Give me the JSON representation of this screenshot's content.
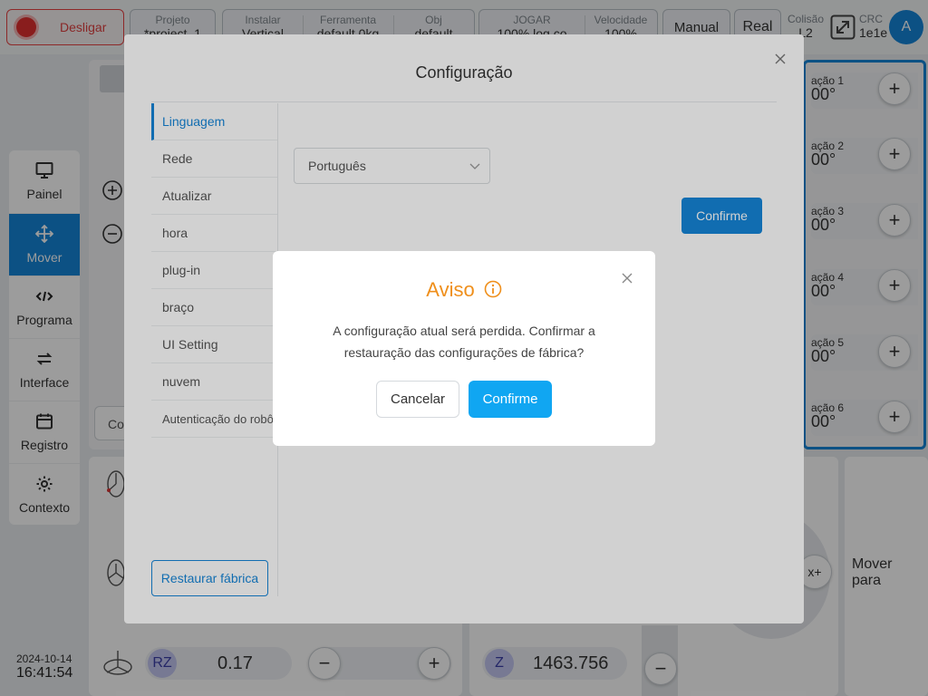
{
  "topbar": {
    "power_label": "Desligar",
    "project": {
      "label": "Projeto",
      "value": "*project_1"
    },
    "install": {
      "label": "Instalar",
      "value": "Vertical"
    },
    "tool": {
      "label": "Ferramenta",
      "value": "default    0kg"
    },
    "obj": {
      "label": "Obj",
      "value": "default"
    },
    "jog": {
      "label": "JOGAR",
      "value": "100%    log co"
    },
    "speed": {
      "label": "Velocidade",
      "value": "100%"
    },
    "mode": "Manual",
    "real": "Real",
    "collision": {
      "label": "Colisão",
      "value": "L2"
    },
    "crc": {
      "label": "CRC",
      "value": "1e1e"
    },
    "avatar": "A"
  },
  "nav": [
    {
      "label": "Painel",
      "icon": "monitor-icon"
    },
    {
      "label": "Mover",
      "icon": "move-icon",
      "active": true
    },
    {
      "label": "Programa",
      "icon": "code-icon"
    },
    {
      "label": "Interface",
      "icon": "swap-icon"
    },
    {
      "label": "Registro",
      "icon": "calendar-icon"
    },
    {
      "label": "Contexto",
      "icon": "gear-icon"
    }
  ],
  "datetime": {
    "date": "2024-10-14",
    "time": "16:41:54"
  },
  "background": {
    "joints": [
      {
        "name": "ação 1",
        "value": "00°"
      },
      {
        "name": "ação 2",
        "value": "00°"
      },
      {
        "name": "ação 3",
        "value": "00°"
      },
      {
        "name": "ação 4",
        "value": "00°"
      },
      {
        "name": "ação 5",
        "value": "00°"
      },
      {
        "name": "ação 6",
        "value": "00°"
      }
    ],
    "co_label": "Co",
    "move_to": "Mover para",
    "rz": {
      "axis": "RZ",
      "value": "0.17"
    },
    "z": {
      "axis": "Z",
      "value": "1463.756"
    },
    "x_plus": "x+"
  },
  "config": {
    "title": "Configuração",
    "menu": [
      "Linguagem",
      "Rede",
      "Atualizar",
      "hora",
      "plug-in",
      "braço",
      "UI Setting",
      "nuvem",
      "Autenticação do robô"
    ],
    "language_value": "Português",
    "confirm_label": "Confirme",
    "restore_label": "Restaurar fábrica"
  },
  "modal": {
    "title": "Aviso",
    "message": "A configuração atual será perdida. Confirmar a restauração das configurações de fábrica?",
    "cancel": "Cancelar",
    "confirm": "Confirme"
  },
  "colors": {
    "accent": "#1585d8",
    "warning": "#ef8f1b",
    "confirm": "#10a6f2",
    "danger": "#e03030"
  }
}
